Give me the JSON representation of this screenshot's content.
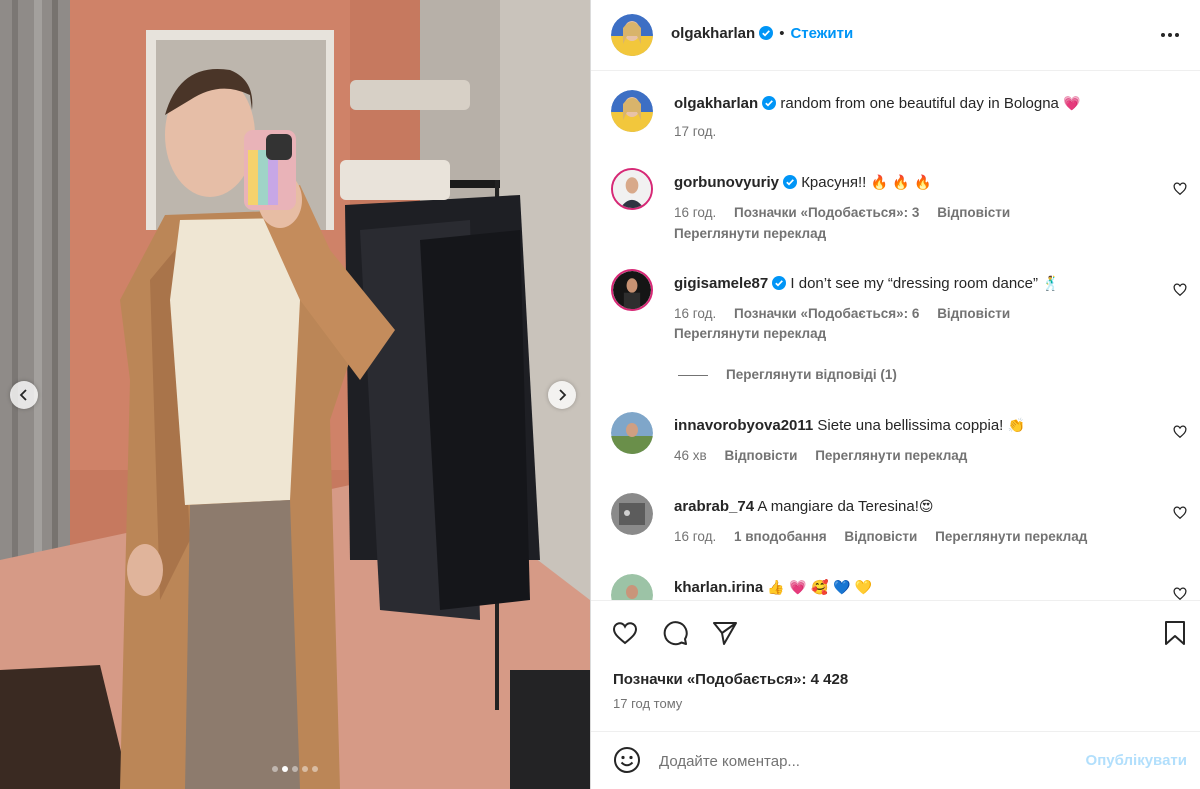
{
  "post": {
    "author": "olgakharlan",
    "follow_label": "Стежити",
    "separator": "•",
    "caption": "random from one beautiful day in Bologna",
    "caption_emoji": "💗",
    "caption_time": "17 год."
  },
  "comments": [
    {
      "username": "gorbunovyuriy",
      "verified": true,
      "text": "Красуня!!",
      "emoji": "🔥 🔥 🔥",
      "time": "16 год.",
      "likes": "Позначки «Подобається»: 3",
      "reply": "Відповісти",
      "translate": "Переглянути переклад"
    },
    {
      "username": "gigisamele87",
      "verified": true,
      "text": "I don’t see my “dressing room dance”",
      "emoji": "🕺",
      "time": "16 год.",
      "likes": "Позначки «Подобається»: 6",
      "reply": "Відповісти",
      "translate": "Переглянути переклад"
    },
    {
      "username": "innavorobyova2011",
      "verified": false,
      "text": "Siete una bellissima coppia!",
      "emoji": "👏",
      "time": "46 хв",
      "reply": "Відповісти",
      "translate": "Переглянути переклад"
    },
    {
      "username": "arabrab_74",
      "verified": false,
      "text": "A mangiare da Teresina!",
      "emoji": "😍",
      "time": "16 год.",
      "likes": "1 вподобання",
      "reply": "Відповісти",
      "translate": "Переглянути переклад"
    },
    {
      "username": "kharlan.irina",
      "verified": false,
      "text": "",
      "emoji": "👍 💗 🥰 💙 💛"
    }
  ],
  "view_replies": "Переглянути відповіді (1)",
  "footer": {
    "likes": "Позначки «Подобається»: 4 428",
    "time": "17 год тому",
    "comment_placeholder": "Додайте коментар...",
    "publish_label": "Опублікувати"
  },
  "carousel": {
    "total": 5,
    "active": 1
  },
  "icons": {
    "verified": "verified-badge-icon",
    "more": "more-options-icon",
    "like": "heart-icon",
    "comment": "comment-icon",
    "share": "share-icon",
    "save": "bookmark-icon",
    "emoji": "emoji-icon",
    "prev": "chevron-left-icon",
    "next": "chevron-right-icon"
  },
  "colors": {
    "link": "#0095f6",
    "publish_disabled": "#b2dffc",
    "verified": "#0095f6",
    "secondary_text": "#737373",
    "primary_text": "#262626"
  }
}
